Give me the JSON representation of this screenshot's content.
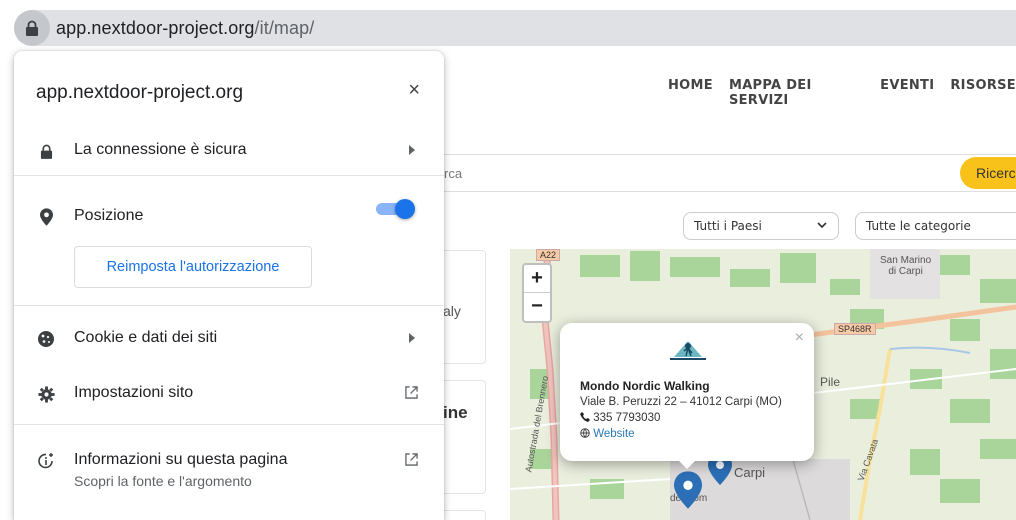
{
  "browser": {
    "url_host": "app.nextdoor-project.org",
    "url_path": "/it/map/"
  },
  "page": {
    "nav": [
      "HOME",
      "MAPPA DEI SERVIZI",
      "EVENTI",
      "RISORSE"
    ],
    "search_placeholder_partial": "rca",
    "search_button_partial": "Ricerca",
    "country_select": "Tutti i Paesi",
    "category_select": "Tutte le categorie",
    "card1_partial": "aly",
    "card2_partial": "ine"
  },
  "map": {
    "zoom_in": "+",
    "zoom_out": "−",
    "labels": {
      "a22": "A22",
      "san_marino": "San Marino\ndi Carpi",
      "sp468r": "SP468R",
      "pile": "Pile",
      "carpi": "Carpi",
      "autostrada": "Autostrada del Brennero",
      "via_cavata": "Via Cavata",
      "del_com": "del Com"
    },
    "popup": {
      "close": "×",
      "name": "Mondo Nordic Walking",
      "address": "Viale B. Peruzzi 22 – 41012 Carpi (MO)",
      "phone": "335 7793030",
      "website": "Website"
    }
  },
  "site_info": {
    "title": "app.nextdoor-project.org",
    "close": "×",
    "connection": "La connessione è sicura",
    "position": "Posizione",
    "position_enabled": true,
    "reset_permission": "Reimposta l'autorizzazione",
    "cookies": "Cookie e dati dei siti",
    "site_settings": "Impostazioni sito",
    "page_info": "Informazioni su questa pagina",
    "page_info_sub": "Scopri la fonte e l'argomento"
  },
  "colors": {
    "accent_blue": "#1a73e8",
    "search_yellow": "#f9c21a",
    "marker_blue": "#2c6fb6"
  }
}
